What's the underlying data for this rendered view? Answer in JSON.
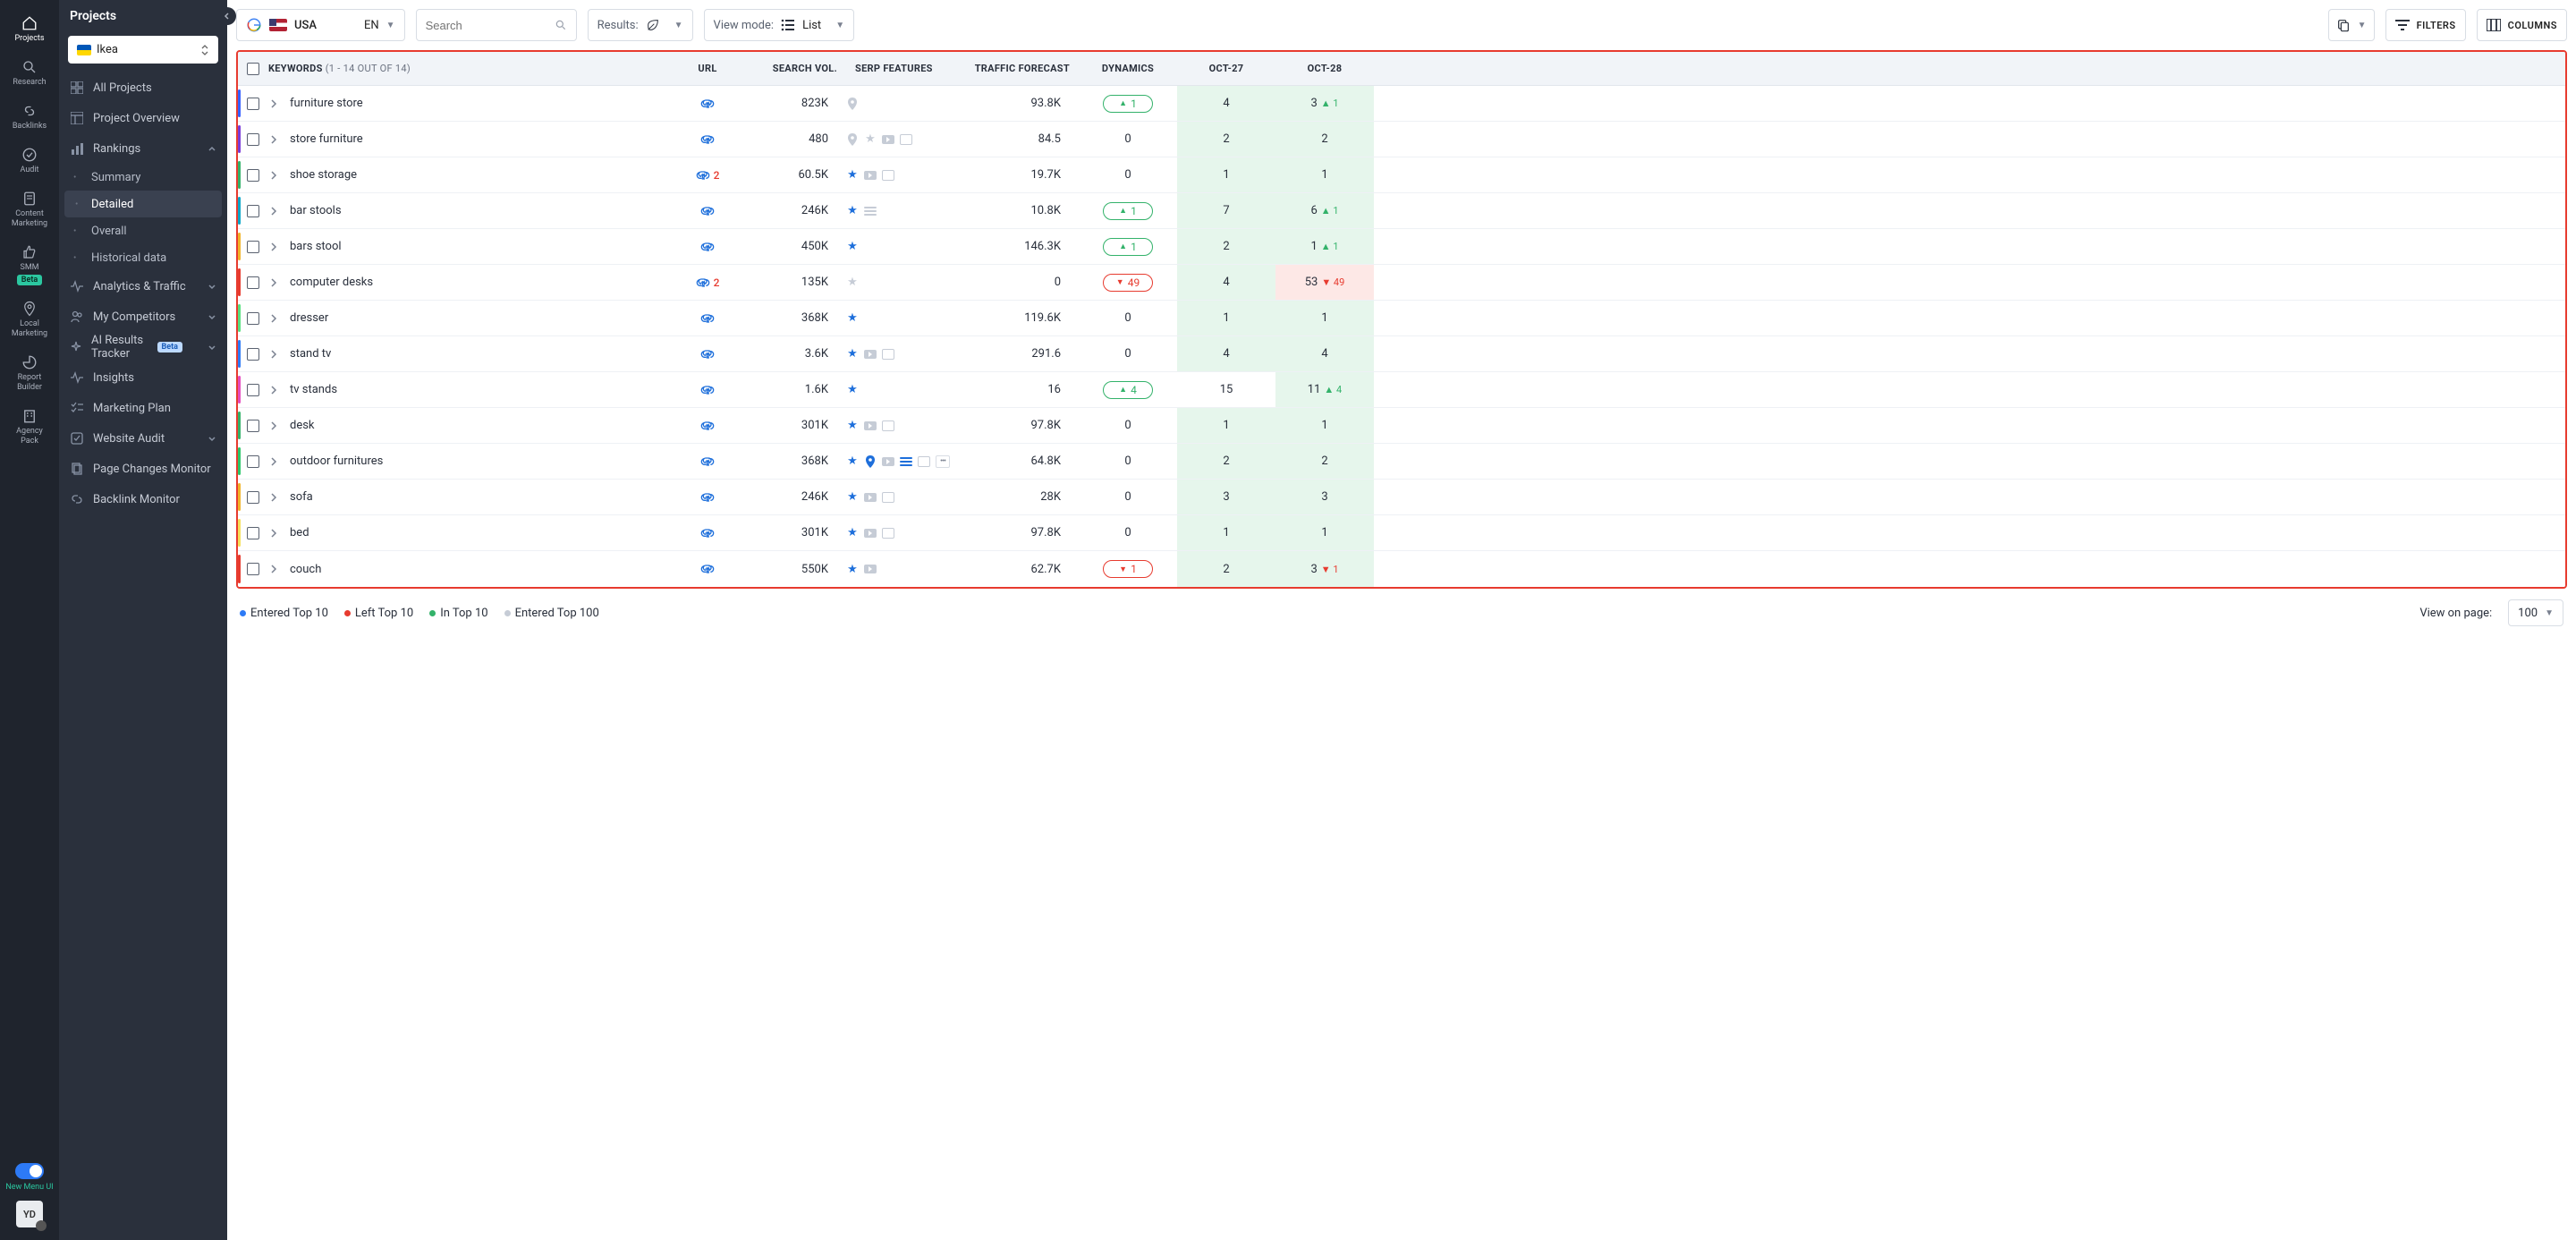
{
  "rail": {
    "items": [
      {
        "label": "Projects",
        "icon": "home",
        "active": true
      },
      {
        "label": "Research",
        "icon": "search"
      },
      {
        "label": "Backlinks",
        "icon": "link"
      },
      {
        "label": "Audit",
        "icon": "check"
      },
      {
        "label": "Content\nMarketing",
        "icon": "doc"
      },
      {
        "label": "SMM",
        "icon": "thumb",
        "badge": "Beta"
      },
      {
        "label": "Local\nMarketing",
        "icon": "pin"
      },
      {
        "label": "Report\nBuilder",
        "icon": "pie"
      },
      {
        "label": "Agency\nPack",
        "icon": "building"
      }
    ],
    "menu_toggle_label": "New Menu UI",
    "avatar": "YD"
  },
  "sidebar": {
    "title": "Projects",
    "project": "Ikea",
    "items": [
      {
        "label": "All Projects",
        "icon": "grid"
      },
      {
        "label": "Project Overview",
        "icon": "layout"
      },
      {
        "label": "Rankings",
        "icon": "bars",
        "expanded": true,
        "children": [
          {
            "label": "Summary"
          },
          {
            "label": "Detailed",
            "active": true
          },
          {
            "label": "Overall"
          },
          {
            "label": "Historical data"
          }
        ]
      },
      {
        "label": "Analytics & Traffic",
        "icon": "pulse",
        "chev": true
      },
      {
        "label": "My Competitors",
        "icon": "users",
        "chev": true
      },
      {
        "label": "AI Results Tracker",
        "icon": "sparkle",
        "chev": true,
        "badge": "Beta"
      },
      {
        "label": "Insights",
        "icon": "bulb"
      },
      {
        "label": "Marketing Plan",
        "icon": "checklist"
      },
      {
        "label": "Website Audit",
        "icon": "shield",
        "chev": true
      },
      {
        "label": "Page Changes Monitor",
        "icon": "pages"
      },
      {
        "label": "Backlink Monitor",
        "icon": "linkmon"
      }
    ]
  },
  "toolbar": {
    "country": "USA",
    "lang": "EN",
    "search_placeholder": "Search",
    "results_label": "Results:",
    "viewmode_label": "View mode:",
    "viewmode_value": "List",
    "filters_label": "FILTERS",
    "columns_label": "COLUMNS"
  },
  "table": {
    "header": {
      "keywords": "KEYWORDS",
      "keywords_sub": "(1 - 14 OUT OF 14)",
      "url": "URL",
      "search_vol": "SEARCH VOL.",
      "serp_features": "SERP FEATURES",
      "traffic_forecast": "TRAFFIC FORECAST",
      "dynamics": "DYNAMICS",
      "date1": "OCT-27",
      "date2": "OCT-28"
    },
    "rows": [
      {
        "acc": "#3661ff",
        "kw": "furniture store",
        "url_n": 0,
        "sv": "823K",
        "sf": [
          "pin-g"
        ],
        "tf": "93.8K",
        "dyn": {
          "dir": "up",
          "n": "1"
        },
        "d1": {
          "v": "4",
          "bg": "g"
        },
        "d2": {
          "v": "3",
          "bg": "g",
          "delta": {
            "dir": "up",
            "n": "1"
          }
        }
      },
      {
        "acc": "#7a3bd8",
        "kw": "store furniture",
        "url_n": 0,
        "sv": "480",
        "sf": [
          "pin-g",
          "star-g",
          "yt-g",
          "img-g"
        ],
        "tf": "84.5",
        "dyn": {
          "n": "0"
        },
        "d1": {
          "v": "2",
          "bg": "g"
        },
        "d2": {
          "v": "2",
          "bg": "g"
        }
      },
      {
        "acc": "#33b26a",
        "kw": "shoe storage",
        "url_n": 2,
        "sv": "60.5K",
        "sf": [
          "star-b",
          "yt-g",
          "img-g"
        ],
        "tf": "19.7K",
        "dyn": {
          "n": "0"
        },
        "d1": {
          "v": "1",
          "bg": "g"
        },
        "d2": {
          "v": "1",
          "bg": "g"
        }
      },
      {
        "acc": "#0aa7c9",
        "kw": "bar stools",
        "url_n": 0,
        "sv": "246K",
        "sf": [
          "star-b",
          "lines-g"
        ],
        "tf": "10.8K",
        "dyn": {
          "dir": "up",
          "n": "1"
        },
        "d1": {
          "v": "7",
          "bg": "g"
        },
        "d2": {
          "v": "6",
          "bg": "g",
          "delta": {
            "dir": "up",
            "n": "1"
          }
        }
      },
      {
        "acc": "#f0b429",
        "kw": "bars stool",
        "url_n": 0,
        "sv": "450K",
        "sf": [
          "star-b"
        ],
        "tf": "146.3K",
        "dyn": {
          "dir": "up",
          "n": "1"
        },
        "d1": {
          "v": "2",
          "bg": "g"
        },
        "d2": {
          "v": "1",
          "bg": "g",
          "delta": {
            "dir": "up",
            "n": "1"
          }
        }
      },
      {
        "acc": "#e73b2f",
        "kw": "computer desks",
        "url_n": 2,
        "sv": "135K",
        "sf": [
          "star-g"
        ],
        "tf": "0",
        "dyn": {
          "dir": "down",
          "n": "49"
        },
        "d1": {
          "v": "4",
          "bg": "g"
        },
        "d2": {
          "v": "53",
          "bg": "r",
          "delta": {
            "dir": "down",
            "n": "49"
          }
        }
      },
      {
        "acc": "#57e07f",
        "kw": "dresser",
        "url_n": 0,
        "sv": "368K",
        "sf": [
          "star-b"
        ],
        "tf": "119.6K",
        "dyn": {
          "n": "0"
        },
        "d1": {
          "v": "1",
          "bg": "g"
        },
        "d2": {
          "v": "1",
          "bg": "g"
        }
      },
      {
        "acc": "#2d7af6",
        "kw": "stand tv",
        "url_n": 0,
        "sv": "3.6K",
        "sf": [
          "star-b",
          "yt-g",
          "img-g"
        ],
        "tf": "291.6",
        "dyn": {
          "n": "0"
        },
        "d1": {
          "v": "4",
          "bg": "g"
        },
        "d2": {
          "v": "4",
          "bg": "g"
        }
      },
      {
        "acc": "#e54bbf",
        "kw": "tv stands",
        "url_n": 0,
        "sv": "1.6K",
        "sf": [
          "star-b"
        ],
        "tf": "16",
        "dyn": {
          "dir": "up",
          "n": "4"
        },
        "d1": {
          "v": "15"
        },
        "d2": {
          "v": "11",
          "bg": "g",
          "delta": {
            "dir": "up",
            "n": "4"
          }
        }
      },
      {
        "acc": "#33b26a",
        "kw": "desk",
        "url_n": 0,
        "sv": "301K",
        "sf": [
          "star-b",
          "yt-g",
          "img-g"
        ],
        "tf": "97.8K",
        "dyn": {
          "n": "0"
        },
        "d1": {
          "v": "1",
          "bg": "g"
        },
        "d2": {
          "v": "1",
          "bg": "g"
        }
      },
      {
        "acc": "#2bc76a",
        "kw": "outdoor furnitures",
        "url_n": 0,
        "sv": "368K",
        "sf": [
          "star-b",
          "pin-b",
          "yt-g",
          "lines-b",
          "img-g",
          "more"
        ],
        "tf": "64.8K",
        "dyn": {
          "n": "0"
        },
        "d1": {
          "v": "2",
          "bg": "g"
        },
        "d2": {
          "v": "2",
          "bg": "g"
        }
      },
      {
        "acc": "#f0b429",
        "kw": "sofa",
        "url_n": 0,
        "sv": "246K",
        "sf": [
          "star-b",
          "yt-g",
          "img-g"
        ],
        "tf": "28K",
        "dyn": {
          "n": "0"
        },
        "d1": {
          "v": "3",
          "bg": "g"
        },
        "d2": {
          "v": "3",
          "bg": "g"
        }
      },
      {
        "acc": "#f5e05a",
        "kw": "bed",
        "url_n": 0,
        "sv": "301K",
        "sf": [
          "star-b",
          "yt-g",
          "img-g"
        ],
        "tf": "97.8K",
        "dyn": {
          "n": "0"
        },
        "d1": {
          "v": "1",
          "bg": "g"
        },
        "d2": {
          "v": "1",
          "bg": "g"
        }
      },
      {
        "acc": "#e73b2f",
        "kw": "couch",
        "url_n": 0,
        "sv": "550K",
        "sf": [
          "star-b",
          "yt-g"
        ],
        "tf": "62.7K",
        "dyn": {
          "dir": "down",
          "n": "1"
        },
        "d1": {
          "v": "2",
          "bg": "g"
        },
        "d2": {
          "v": "3",
          "bg": "g",
          "delta": {
            "dir": "down",
            "n": "1"
          }
        }
      }
    ]
  },
  "legend": [
    {
      "color": "#2d7af6",
      "label": "Entered Top 10"
    },
    {
      "color": "#e73b2f",
      "label": "Left Top 10"
    },
    {
      "color": "#33b26a",
      "label": "In Top 10"
    },
    {
      "color": "#c6ccd6",
      "label": "Entered Top 100"
    }
  ],
  "footer": {
    "view_label": "View on page:",
    "view_value": "100"
  }
}
